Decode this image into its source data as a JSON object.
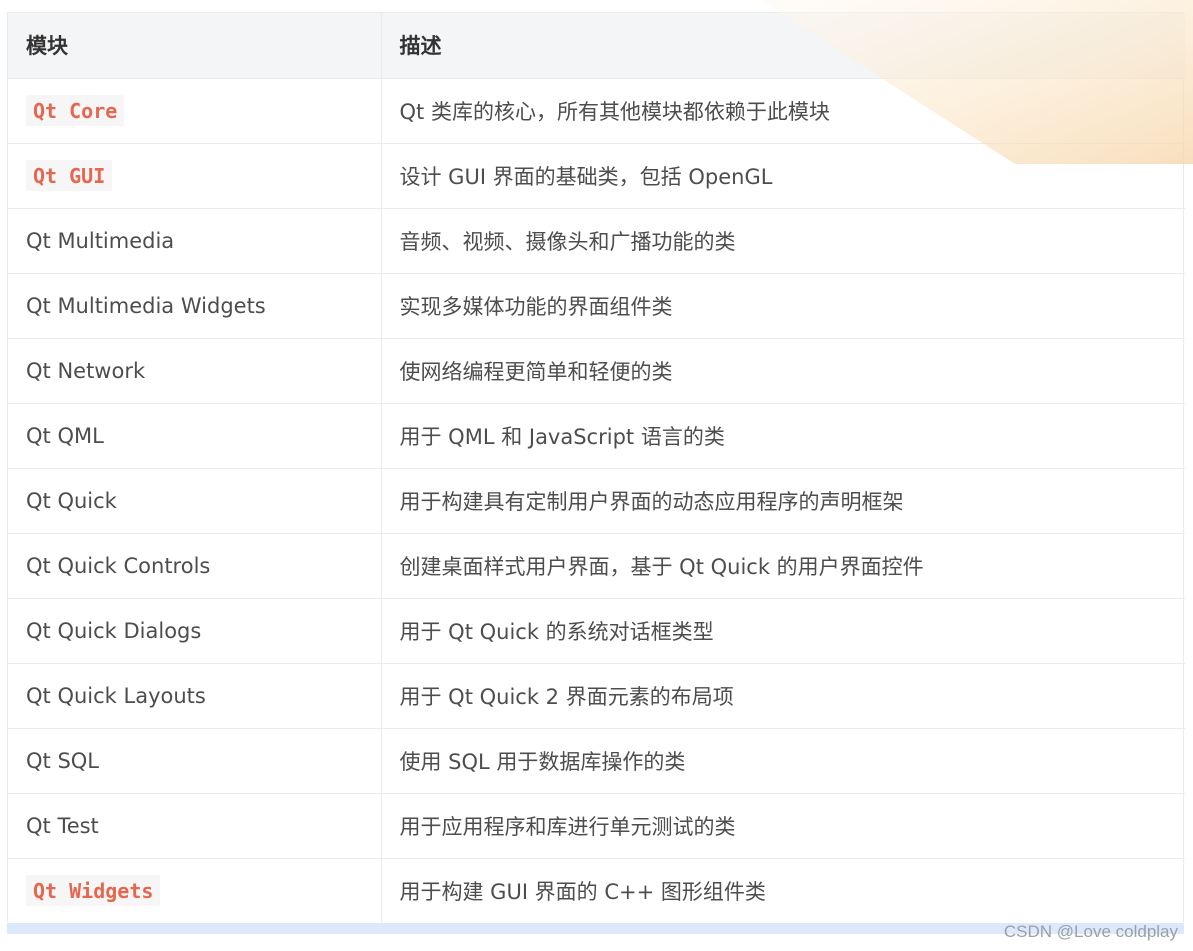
{
  "table": {
    "header": {
      "module": "模块",
      "description": "描述"
    },
    "rows": [
      {
        "module": "Qt Core",
        "description": "Qt 类库的核心，所有其他模块都依赖于此模块",
        "code_style": true
      },
      {
        "module": "Qt GUI",
        "description": "设计 GUI 界面的基础类，包括 OpenGL",
        "code_style": true
      },
      {
        "module": "Qt Multimedia",
        "description": "音频、视频、摄像头和广播功能的类",
        "code_style": false
      },
      {
        "module": "Qt Multimedia Widgets",
        "description": "实现多媒体功能的界面组件类",
        "code_style": false
      },
      {
        "module": "Qt Network",
        "description": "使网络编程更简单和轻便的类",
        "code_style": false
      },
      {
        "module": "Qt QML",
        "description": "用于 QML 和 JavaScript 语言的类",
        "code_style": false
      },
      {
        "module": "Qt Quick",
        "description": "用于构建具有定制用户界面的动态应用程序的声明框架",
        "code_style": false
      },
      {
        "module": "Qt Quick Controls",
        "description": "创建桌面样式用户界面，基于 Qt Quick 的用户界面控件",
        "code_style": false
      },
      {
        "module": "Qt Quick Dialogs",
        "description": "用于 Qt Quick 的系统对话框类型",
        "code_style": false
      },
      {
        "module": "Qt Quick Layouts",
        "description": "用于 Qt Quick 2 界面元素的布局项",
        "code_style": false
      },
      {
        "module": "Qt SQL",
        "description": "使用 SQL 用于数据库操作的类",
        "code_style": false
      },
      {
        "module": "Qt Test",
        "description": "用于应用程序和库进行单元测试的类",
        "code_style": false
      },
      {
        "module": "Qt Widgets",
        "description": "用于构建 GUI 界面的 C++ 图形组件类",
        "code_style": true
      }
    ]
  },
  "watermark": {
    "text": "CSDN @Love coldplay"
  },
  "colors": {
    "header_background": "#f4f5f7",
    "border": "#e8ebef",
    "text": "#4d4d4d",
    "code_text": "#e76650",
    "code_background": "#f6f6f6",
    "bottom_scroll_bar": "#dce8fb",
    "decorative_overlay": "#fbe7c9"
  }
}
